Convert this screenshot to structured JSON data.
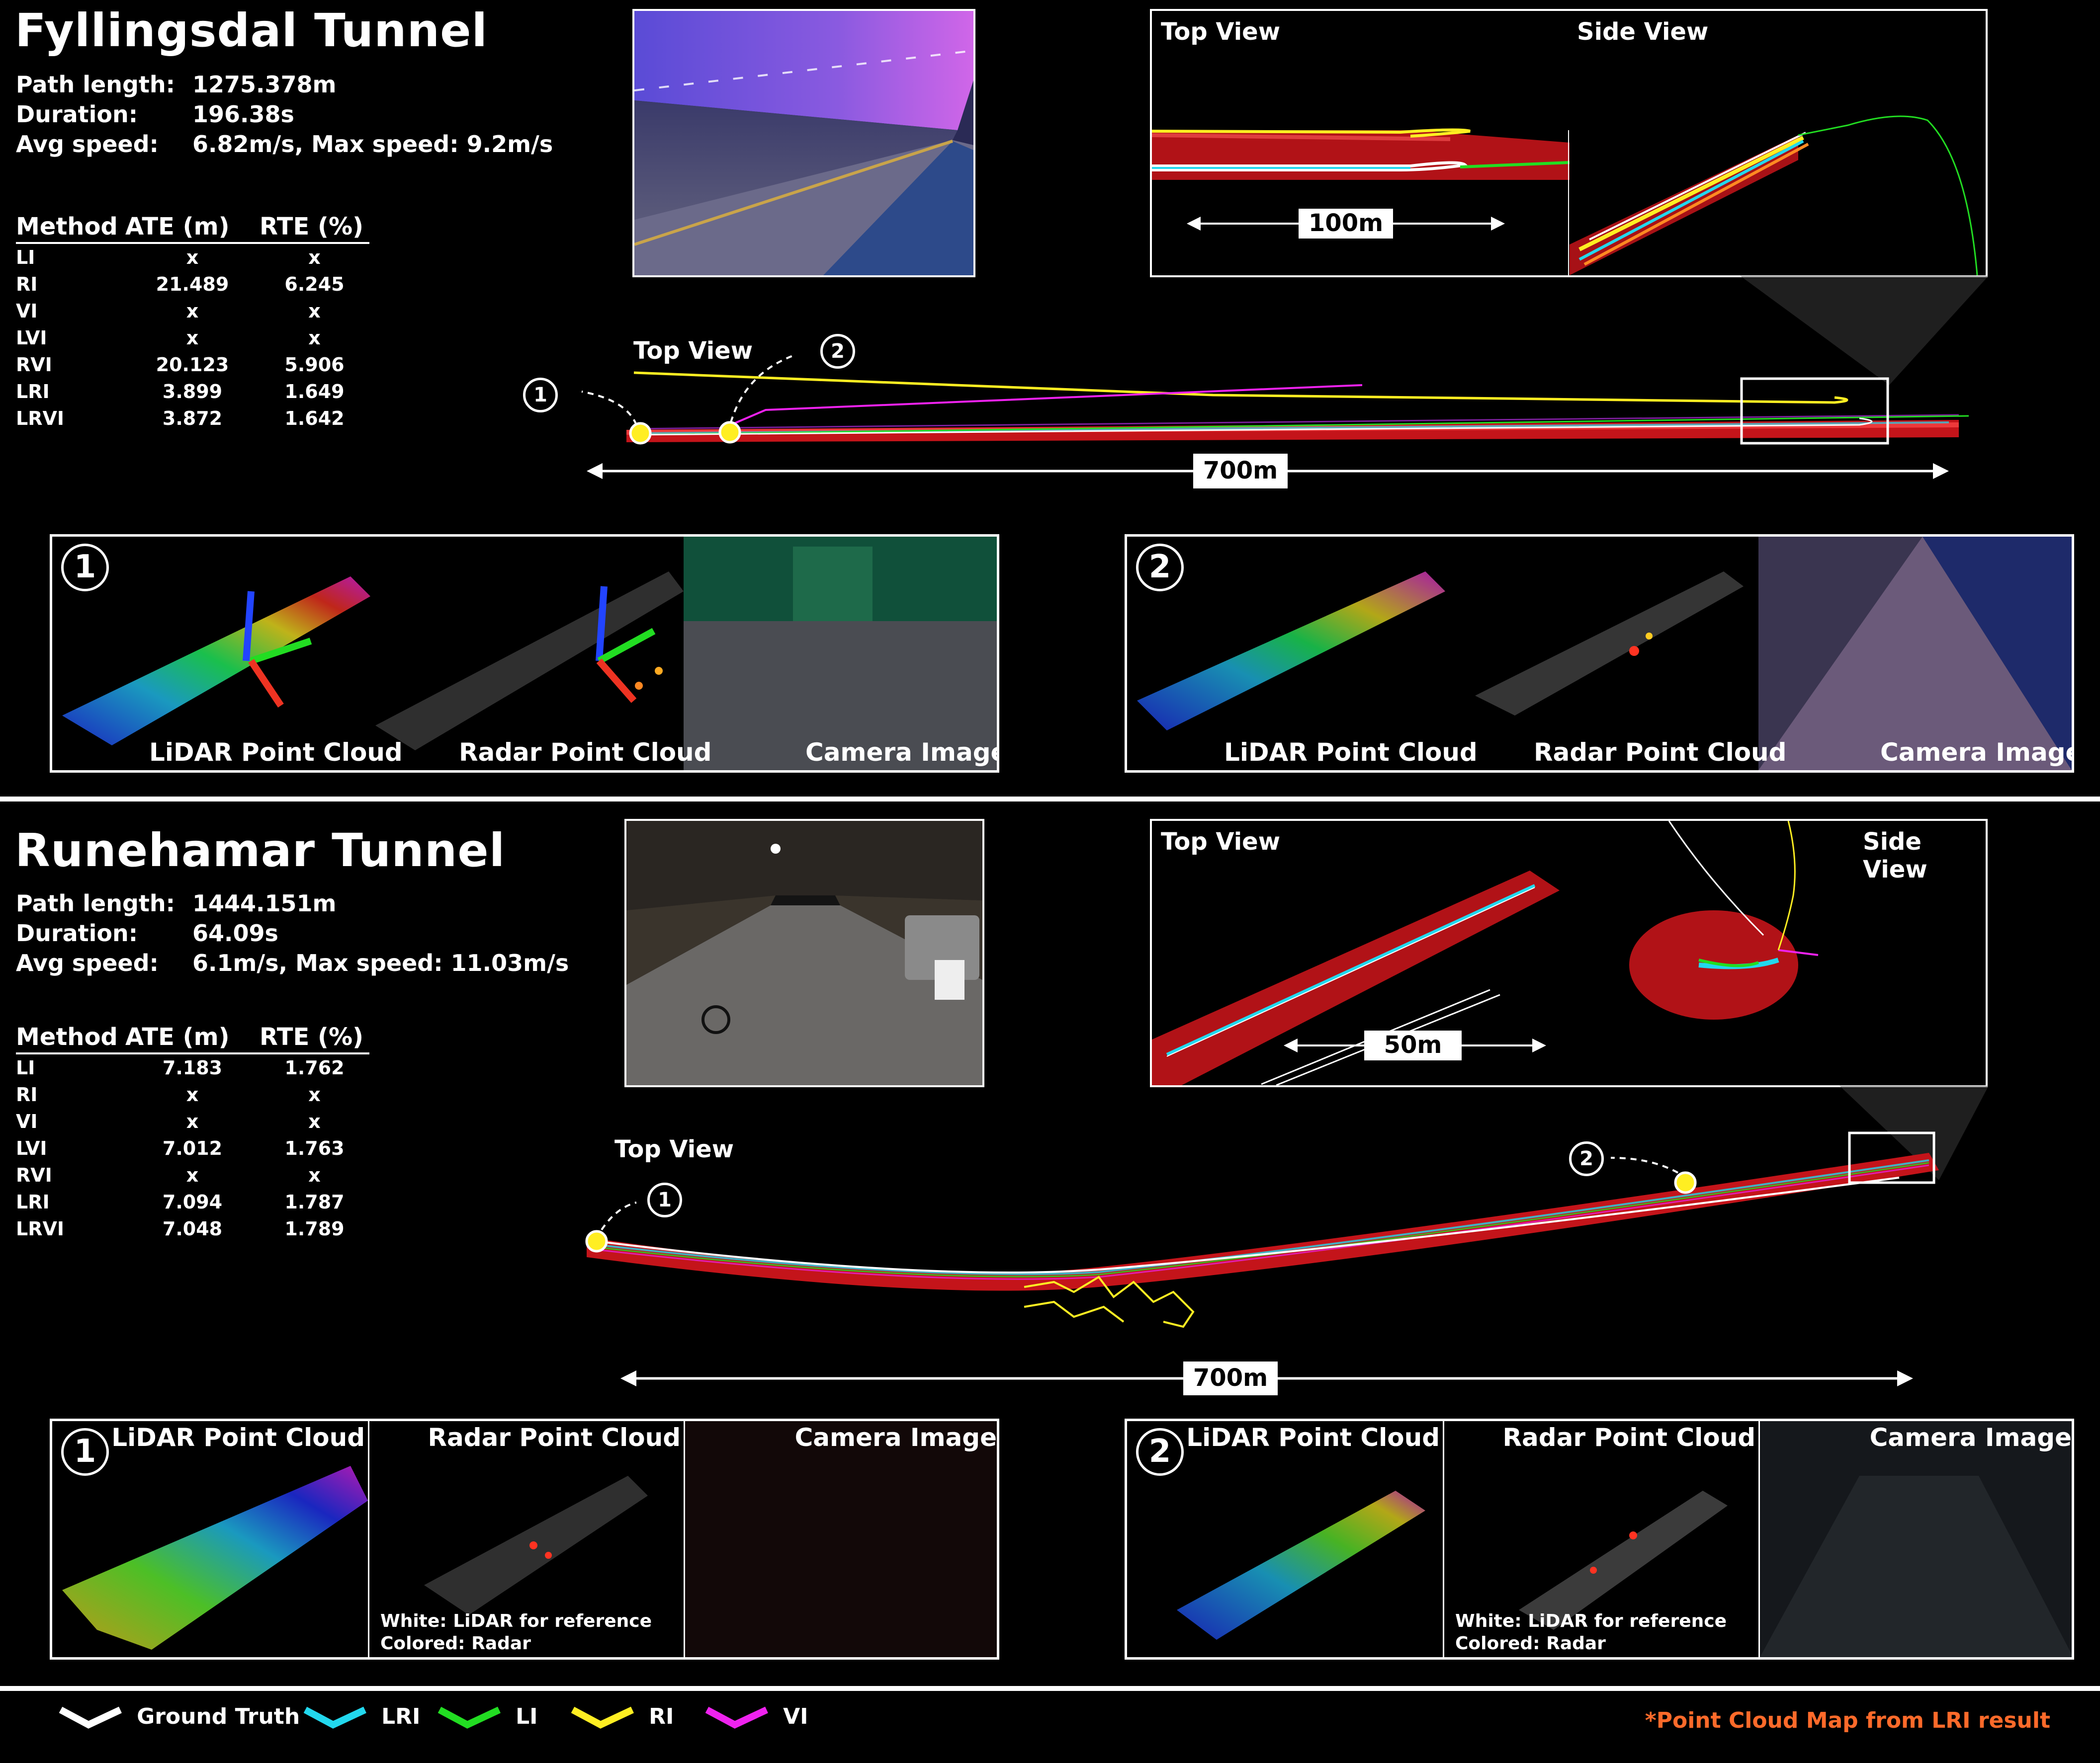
{
  "fyllingsdal": {
    "title": "Fyllingsdal Tunnel",
    "stats": [
      {
        "label": "Path length:",
        "value": "1275.378m"
      },
      {
        "label": "Duration:",
        "value": "196.38s"
      },
      {
        "label": "Avg speed:",
        "value": "6.82m/s, Max speed: 9.2m/s"
      }
    ],
    "table": {
      "headers": [
        "Method",
        "ATE (m)",
        "RTE (%)"
      ],
      "rows": [
        [
          "LI",
          "x",
          "x"
        ],
        [
          "RI",
          "21.489",
          "6.245"
        ],
        [
          "VI",
          "x",
          "x"
        ],
        [
          "LVI",
          "x",
          "x"
        ],
        [
          "RVI",
          "20.123",
          "5.906"
        ],
        [
          "LRI",
          "3.899",
          "1.649"
        ],
        [
          "LRVI",
          "3.872",
          "1.642"
        ]
      ]
    },
    "inset": {
      "top_view": "Top View",
      "side_view": "Side View",
      "scale": "100m"
    },
    "map": {
      "top_view": "Top View",
      "scale": "700m",
      "marker1": "1",
      "marker2": "2"
    },
    "panel1": {
      "number": "1",
      "lidar": "LiDAR Point Cloud",
      "radar": "Radar Point Cloud",
      "camera": "Camera Image"
    },
    "panel2": {
      "number": "2",
      "lidar": "LiDAR Point Cloud",
      "radar": "Radar Point Cloud",
      "camera": "Camera Image"
    }
  },
  "runehamar": {
    "title": "Runehamar Tunnel",
    "stats": [
      {
        "label": "Path length:",
        "value": "1444.151m"
      },
      {
        "label": "Duration:",
        "value": "64.09s"
      },
      {
        "label": "Avg speed:",
        "value": "6.1m/s, Max speed: 11.03m/s"
      }
    ],
    "table": {
      "headers": [
        "Method",
        "ATE (m)",
        "RTE (%)"
      ],
      "rows": [
        [
          "LI",
          "7.183",
          "1.762"
        ],
        [
          "RI",
          "x",
          "x"
        ],
        [
          "VI",
          "x",
          "x"
        ],
        [
          "LVI",
          "7.012",
          "1.763"
        ],
        [
          "RVI",
          "x",
          "x"
        ],
        [
          "LRI",
          "7.094",
          "1.787"
        ],
        [
          "LRVI",
          "7.048",
          "1.789"
        ]
      ]
    },
    "inset": {
      "top_view": "Top View",
      "side_view": "Side View",
      "scale": "50m"
    },
    "map": {
      "top_view": "Top View",
      "scale": "700m",
      "marker1": "1",
      "marker2": "2"
    },
    "panel1": {
      "number": "1",
      "lidar": "LiDAR Point Cloud",
      "radar": "Radar Point Cloud",
      "camera": "Camera Image",
      "note1": "White: LiDAR for reference",
      "note2": "Colored: Radar"
    },
    "panel2": {
      "number": "2",
      "lidar": "LiDAR Point Cloud",
      "radar": "Radar Point Cloud",
      "camera": "Camera Image",
      "note1": "White: LiDAR for reference",
      "note2": "Colored: Radar"
    }
  },
  "legend": {
    "items": [
      {
        "label": "Ground Truth",
        "color": "#ffffff"
      },
      {
        "label": "LRI",
        "color": "#22d8ee"
      },
      {
        "label": "LI",
        "color": "#22dd22"
      },
      {
        "label": "RI",
        "color": "#ffee22"
      },
      {
        "label": "VI",
        "color": "#ee22ee"
      }
    ],
    "footnote": "*Point Cloud Map from LRI result",
    "footnote_color": "#ff6a2a"
  }
}
